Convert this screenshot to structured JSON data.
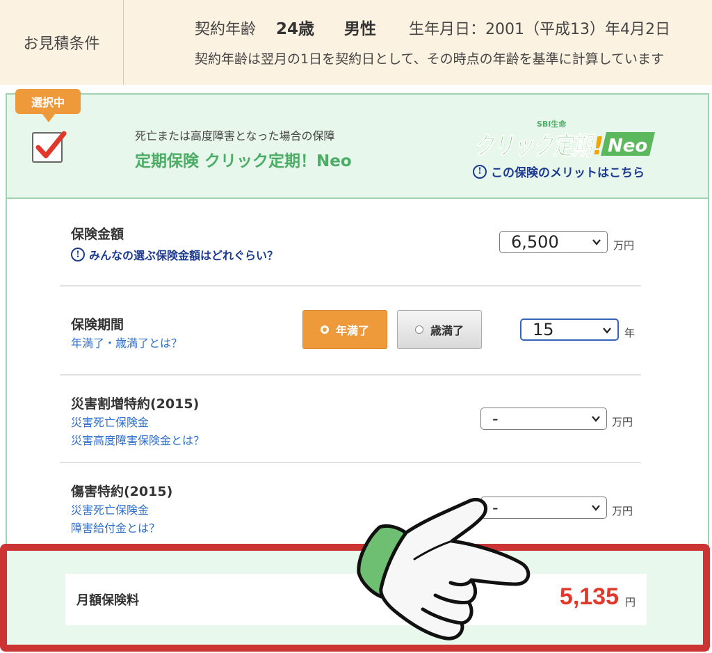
{
  "conditions": {
    "label": "お見積条件",
    "age_label": "契約年齢",
    "age_value": "24歳",
    "gender": "男性",
    "birth_label": "生年月日：",
    "birth_value": "2001（平成13）年4月2日",
    "note": "契約年齢は翌月の1日を契約日として、その時点の年齢を基準に計算しています"
  },
  "product": {
    "badge": "選択中",
    "checked": true,
    "subtitle": "死亡または高度障害となった場合の保障",
    "title": "定期保険 クリック定期！Neo",
    "logo_small": "SBI生命",
    "logo_main": "クリック定期",
    "logo_neo": "Neo",
    "merit_link": "この保険のメリットはこちら",
    "colors": {
      "accent_green": "#4cae66",
      "badge_orange": "#ee9a3b",
      "link_navy": "#1c3a8f"
    }
  },
  "coverage": {
    "title": "保険金額",
    "help": "みんなの選ぶ保険金額はどれぐらい？",
    "selected": "6,500",
    "unit": "万円"
  },
  "term": {
    "title": "保険期間",
    "link": "年満了・歳満了とは？",
    "option_year": "年満了",
    "option_age": "歳満了",
    "selected_option": "年満了",
    "selected": "15",
    "unit": "年"
  },
  "disaster_rider": {
    "title": "災害割増特約(2015)",
    "link1": "災害死亡保険金",
    "link2": "災害高度障害保険金とは？",
    "selected": "-",
    "unit": "万円"
  },
  "injury_rider": {
    "title": "傷害特約(2015)",
    "link1": "災害死亡保険金",
    "link2": "障害給付金とは？",
    "selected": "-",
    "unit": "万円"
  },
  "premium": {
    "label": "月額保険料",
    "value": "5,135",
    "unit": "円",
    "highlight_color": "#cc3333"
  }
}
